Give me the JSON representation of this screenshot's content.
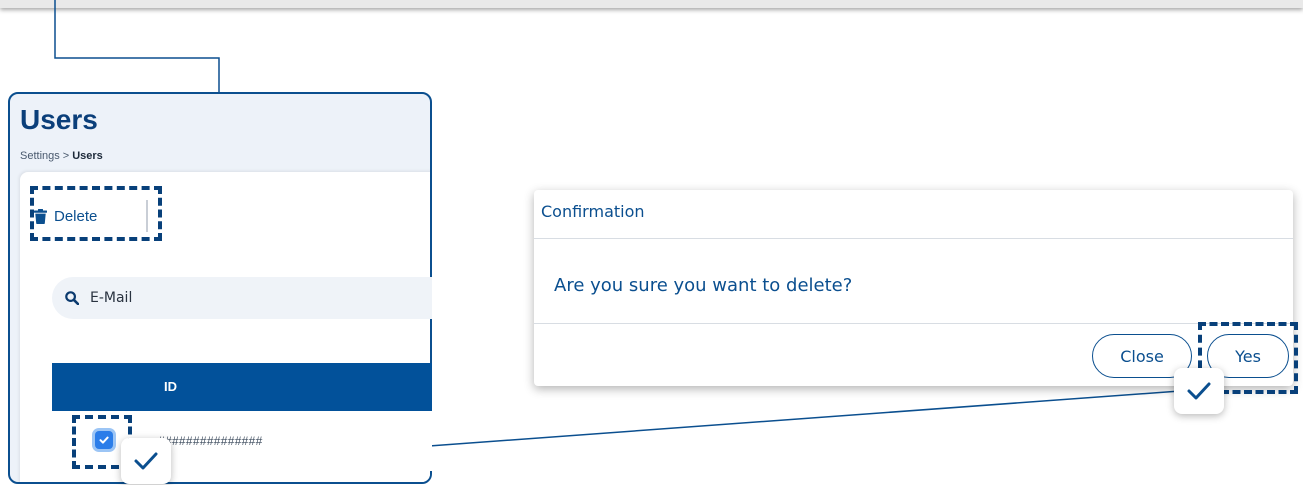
{
  "users": {
    "title": "Users",
    "breadcrumb": {
      "parent": "Settings",
      "separator": ">",
      "current": "Users"
    },
    "toolbar": {
      "delete_label": "Delete",
      "delete_icon": "trash-icon"
    },
    "search": {
      "placeholder": "E-Mail",
      "value": "",
      "icon": "search-icon"
    },
    "table": {
      "columns": [
        "ID"
      ],
      "rows": [
        {
          "checked": true,
          "id": "###############"
        }
      ]
    }
  },
  "dialog": {
    "title": "Confirmation",
    "message": "Are you sure you want to delete?",
    "close_label": "Close",
    "yes_label": "Yes"
  },
  "colors": {
    "accent": "#0b4f8f",
    "table_header": "#02519a",
    "highlight_border": "#08407a",
    "checkbox": "#2b7de9"
  }
}
